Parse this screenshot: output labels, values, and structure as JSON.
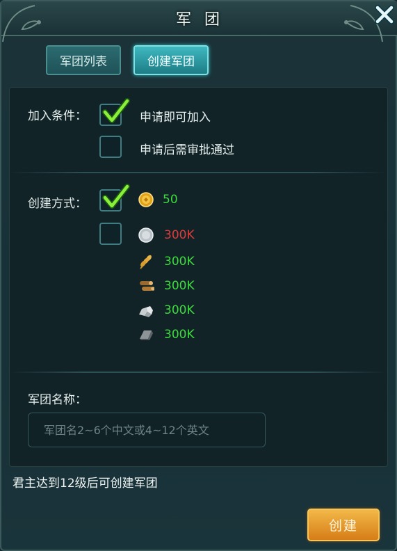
{
  "window": {
    "title": "军 团"
  },
  "tabs": [
    {
      "label": "军团列表"
    },
    {
      "label": "创建军团"
    }
  ],
  "join_conditions": {
    "label": "加入条件：",
    "options": [
      {
        "text": "申请即可加入",
        "checked": true
      },
      {
        "text": "申请后需审批通过",
        "checked": false
      }
    ]
  },
  "create_method": {
    "label": "创建方式：",
    "gold": {
      "icon": "gold-coin-icon",
      "value": "50",
      "color": "#3ddc3d",
      "checked": true
    },
    "resources_checked": false,
    "resources": [
      {
        "icon": "silver-coin-icon",
        "value": "300K",
        "color": "#e03a3a"
      },
      {
        "icon": "wheat-icon",
        "value": "300K",
        "color": "#3ddc3d"
      },
      {
        "icon": "wood-log-icon",
        "value": "300K",
        "color": "#3ddc3d"
      },
      {
        "icon": "stone-icon",
        "value": "300K",
        "color": "#3ddc3d"
      },
      {
        "icon": "iron-ingot-icon",
        "value": "300K",
        "color": "#3ddc3d"
      }
    ]
  },
  "legion_name": {
    "label": "军团名称：",
    "placeholder": "军团名2~6个中文或4~12个英文",
    "value": ""
  },
  "note": "君主达到12级后可创建军团",
  "create_button": {
    "label": "创建"
  }
}
